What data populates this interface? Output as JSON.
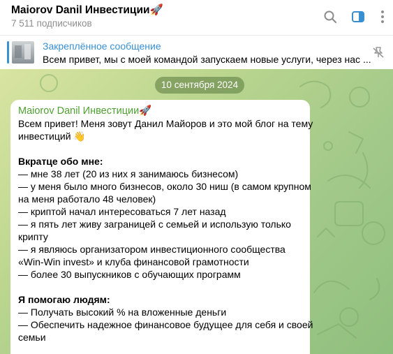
{
  "header": {
    "channel_title": "Maiorov Danil Инвестиции🚀",
    "subscribers": "7 511 подписчиков",
    "icons": [
      "search-icon",
      "sidebar-toggle-icon",
      "more-vertical-icon"
    ]
  },
  "pinned": {
    "title": "Закреплённое сообщение",
    "text": "Всем привет, мы с моей командой запускаем новые услуги, через нас ...",
    "icons": [
      "pinned-thumbnail",
      "unpin-icon"
    ]
  },
  "chat": {
    "date": "10 сентября 2024",
    "message": {
      "author": "Maiorov Danil Инвестиции🚀",
      "lines": [
        "Всем привет! Меня зовут Данил Майоров и это мой блог на тему",
        "инвестиций 👋",
        "",
        "Вкратце обо мне:",
        "— мне 38 лет (20 из них я занимаюсь бизнесом)",
        "— у меня было много бизнесов, около 30 ниш (в самом крупном",
        "на меня работало 48 человек)",
        "— криптой начал интересоваться 7 лет назад",
        "— я пять лет живу заграницей с семьей и использую только",
        "крипту",
        "— я являюсь организатором инвестиционного сообщества",
        "«Win-Win invest» и клуба финансовой грамотности",
        "— более 30 выпускников с обучающих программ",
        "",
        "Я помогаю людям:",
        "— Получать высокий % на вложенные деньги",
        "— Обеспечить надежное финансовое будущее для себя и своей",
        "семьи"
      ]
    }
  },
  "colors": {
    "accent_blue": "#3a8fd0",
    "author_green": "#4fa033",
    "wallpaper": "#b9d58e",
    "date_pill": "#6b8a4d"
  }
}
